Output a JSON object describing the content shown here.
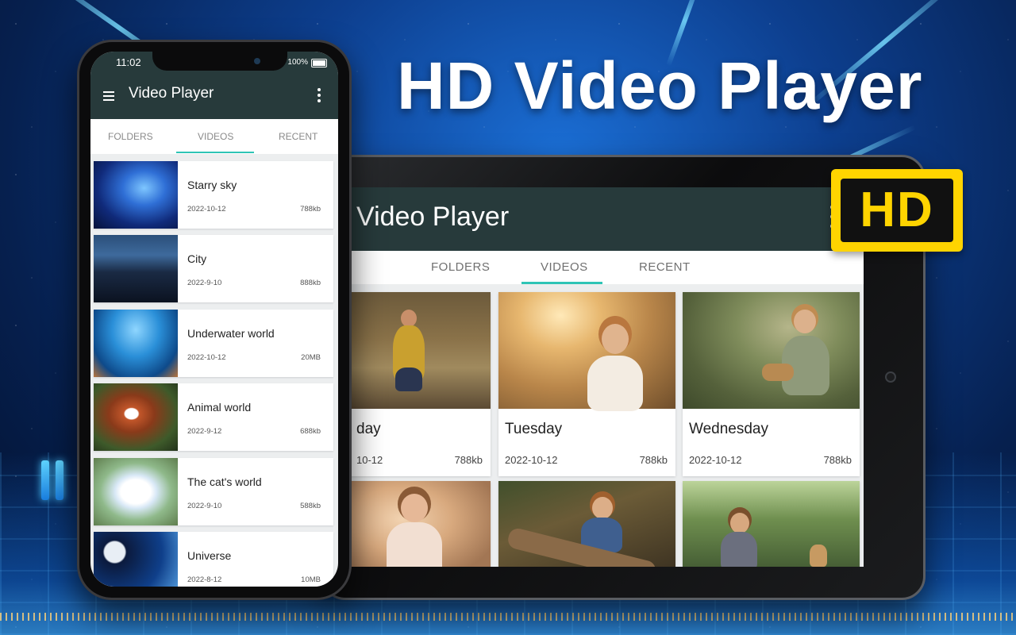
{
  "headline": "HD Video Player",
  "hd_badge": "HD",
  "colors": {
    "appbar": "#273a3b",
    "tab_indicator": "#2ec4b6",
    "badge_yellow": "#ffd400"
  },
  "phone": {
    "status": {
      "time": "11:02",
      "battery": "100%"
    },
    "app_title": "Video Player",
    "icons": {
      "menu": "hamburger-icon",
      "more": "more-vert-icon"
    },
    "tabs": [
      {
        "label": "FOLDERS"
      },
      {
        "label": "VIDEOS",
        "active": true
      },
      {
        "label": "RECENT"
      }
    ],
    "videos": [
      {
        "title": "Starry sky",
        "date": "2022-10-12",
        "size": "788kb"
      },
      {
        "title": "City",
        "date": "2022-9-10",
        "size": "888kb"
      },
      {
        "title": "Underwater world",
        "date": "2022-10-12",
        "size": "20MB"
      },
      {
        "title": "Animal world",
        "date": "2022-9-12",
        "size": "688kb"
      },
      {
        "title": "The cat's world",
        "date": "2022-9-10",
        "size": "588kb"
      },
      {
        "title": "Universe",
        "date": "2022-8-12",
        "size": "10MB"
      }
    ]
  },
  "tablet": {
    "app_title": "Video Player",
    "tabs": [
      {
        "label": "FOLDERS"
      },
      {
        "label": "VIDEOS",
        "active": true
      },
      {
        "label": "RECENT"
      }
    ],
    "videos": [
      {
        "title": "day",
        "date": "10-12",
        "size": "788kb"
      },
      {
        "title": "Tuesday",
        "date": "2022-10-12",
        "size": "788kb"
      },
      {
        "title": "Wednesday",
        "date": "2022-10-12",
        "size": "788kb"
      }
    ]
  }
}
